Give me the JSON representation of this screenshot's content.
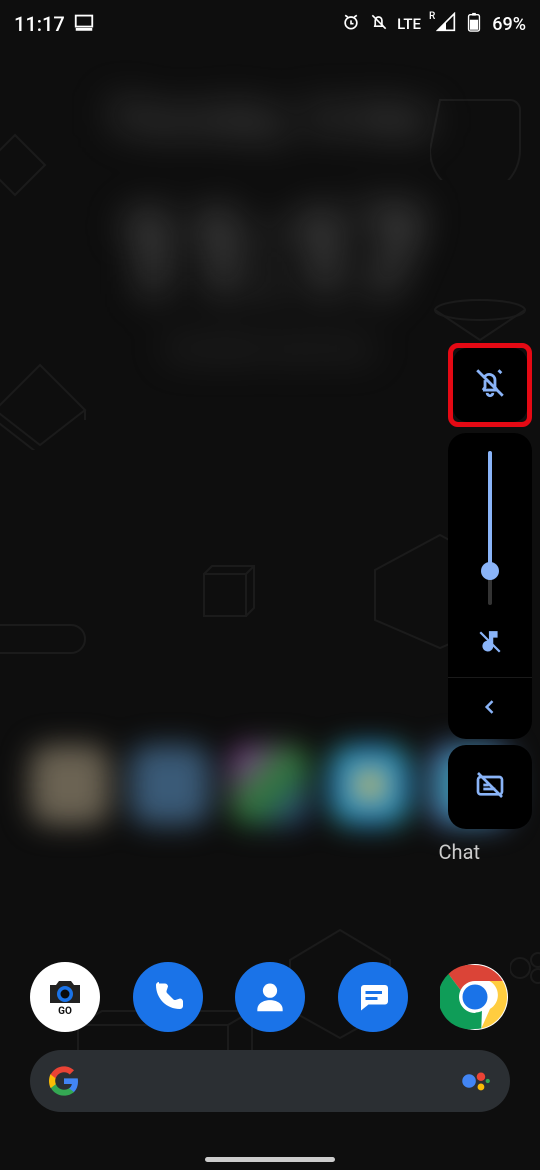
{
  "status": {
    "time": "11:17",
    "icons": {
      "screen_cast": "screen-cast-icon",
      "alarm": "alarm-icon",
      "mute": "bell-off-icon",
      "mobile": "LTE",
      "roaming": "R",
      "signal": "signal-icon",
      "battery": "battery-69-icon",
      "battery_pct": "69%"
    }
  },
  "widget": {
    "day_line": "Thursday, 16 Mar",
    "time_large": "11:17",
    "sub_line": "Set alarm and more"
  },
  "app_row": {
    "visible_label": "Chat"
  },
  "volume_panel": {
    "ring_mode": "silent",
    "slider_pct": 22,
    "media_muted": true,
    "captions_off": true,
    "accent": "#8ab4f8",
    "highlight_border": "#e50914"
  },
  "dock": {
    "apps": [
      {
        "name": "camera-go",
        "label": "GO"
      },
      {
        "name": "phone"
      },
      {
        "name": "contacts"
      },
      {
        "name": "messages"
      },
      {
        "name": "chrome"
      }
    ]
  },
  "search": {
    "placeholder": "",
    "left_icon": "google-g-icon",
    "right_icon": "assistant-icon"
  }
}
